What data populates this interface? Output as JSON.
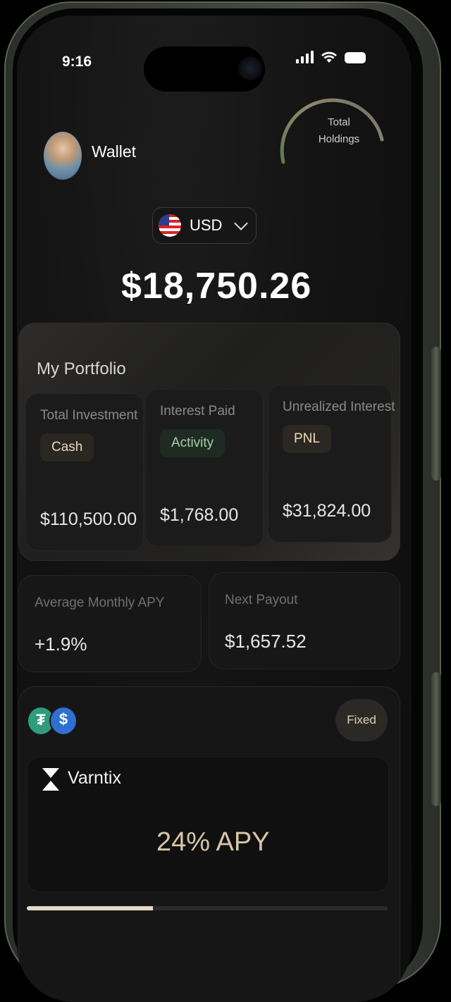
{
  "status_bar": {
    "time": "9:16"
  },
  "gauge": {
    "label_line1": "Total",
    "label_line2": "Holdings"
  },
  "header": {
    "title": "Wallet"
  },
  "currency": {
    "code": "USD"
  },
  "balance": "$18,750.26",
  "portfolio": {
    "title": "My Portfolio",
    "metrics": [
      {
        "label": "Total Investment",
        "tag": "Cash",
        "value": "$110,500.00"
      },
      {
        "label": "Interest Paid",
        "tag": "Activity",
        "value": "$1,768.00"
      },
      {
        "label": "Unrealized Interest",
        "tag": "PNL",
        "value": "$31,824.00"
      }
    ]
  },
  "stats": [
    {
      "label": "Average Monthly APY",
      "value": "+1.9%"
    },
    {
      "label": "Next Payout",
      "value": "$1,657.52"
    }
  ],
  "product": {
    "type_label": "Fixed",
    "brand": "Varntix",
    "apy": "24% APY",
    "progress": 0.35
  },
  "colors": {
    "accent_gold": "#d9c6a6",
    "activity_green": "#a7d0a8",
    "usdt": "#2f9c7a",
    "usdc": "#2e6fd1"
  },
  "icons": [
    "signal-icon",
    "wifi-icon",
    "battery-icon",
    "us-flag-icon",
    "chevron-down-icon",
    "usdt-coin-icon",
    "usdc-coin-icon",
    "varntix-logo-icon"
  ]
}
